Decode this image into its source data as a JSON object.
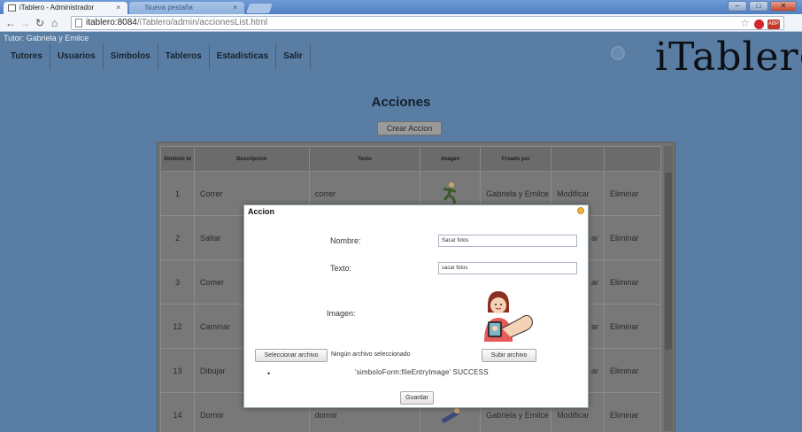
{
  "browser": {
    "tabs": [
      {
        "label": "iTablero - Administrador",
        "active": true
      },
      {
        "label": "Nueva pestaña",
        "active": false
      }
    ],
    "url_host": "itablero:8084",
    "url_path": "/iTablero/admin/accionesList.html"
  },
  "header": {
    "tutor_label": "Tutor: Gabriela y Emilce",
    "menu": [
      "Tutores",
      "Usuarios",
      "Simbolos",
      "Tableros",
      "Estadisticas",
      "Salir"
    ],
    "logo_text": "iTabler"
  },
  "page": {
    "title": "Acciones",
    "create_button": "Crear Accion"
  },
  "table": {
    "columns": [
      "Simbolo Id",
      "Descripcion",
      "Texto",
      "Imagen",
      "Creado por",
      "",
      ""
    ],
    "rows": [
      {
        "id": "1",
        "descripcion": "Correr",
        "texto": "correr",
        "creado": "Gabriela y Emilce",
        "modificar": "Modificar",
        "eliminar": "Eliminar"
      },
      {
        "id": "2",
        "descripcion": "Saltar",
        "texto": "",
        "creado": "",
        "modificar": "ar",
        "eliminar": "Eliminar"
      },
      {
        "id": "3",
        "descripcion": "Comer",
        "texto": "",
        "creado": "",
        "modificar": "ar",
        "eliminar": "Eliminar"
      },
      {
        "id": "12",
        "descripcion": "Caminar",
        "texto": "",
        "creado": "",
        "modificar": "ar",
        "eliminar": "Eliminar"
      },
      {
        "id": "13",
        "descripcion": "Dibujar",
        "texto": "",
        "creado": "",
        "modificar": "ar",
        "eliminar": "Eliminar"
      },
      {
        "id": "14",
        "descripcion": "Dormir",
        "texto": "dormir",
        "creado": "Gabriela y Emilce",
        "modificar": "Modificar",
        "eliminar": "Eliminar"
      }
    ]
  },
  "modal": {
    "title": "Accion",
    "nombre_label": "Nombre:",
    "nombre_value": "Sacar fotos",
    "texto_label": "Texto:",
    "texto_value": "sacar fotos",
    "imagen_label": "Imagen:",
    "select_file_button": "Seleccionar archivo",
    "file_status": "Ningún archivo seleccionado",
    "upload_button": "Subir archivo",
    "success_message": "'simboloForm:fileEntryImage' SUCCESS",
    "save_button": "Guardar"
  }
}
